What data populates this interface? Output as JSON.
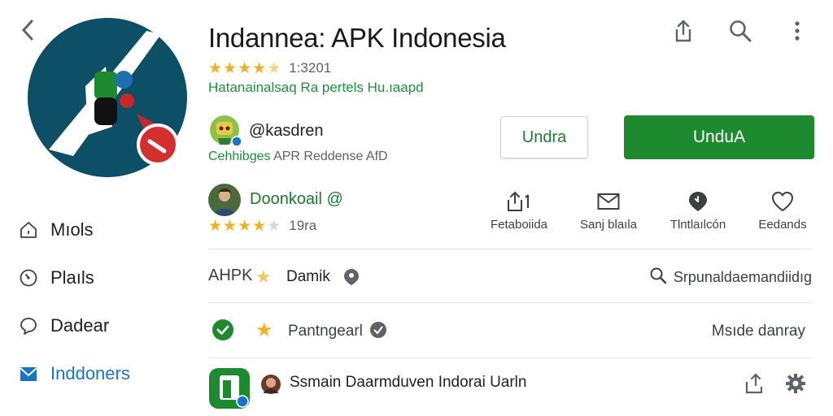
{
  "header": {
    "title": "Indannea: APK Indonesia",
    "rating_count": "1:3201",
    "developer_line": "Hatanainalsaq Ra pertels  Hu.ıaapd"
  },
  "developer": {
    "handle": "@kasdren",
    "sub_green": "Cehhibges",
    "sub_rest": " APR Reddense AfD"
  },
  "buttons": {
    "secondary_label": "Undra",
    "primary_label": "UnduA"
  },
  "sidebar": {
    "items": [
      {
        "label": "Mıols",
        "icon": "home-icon",
        "active": false
      },
      {
        "label": "Plaıls",
        "icon": "clock-icon",
        "active": false
      },
      {
        "label": "Dadear",
        "icon": "chat-bubble-icon",
        "active": false
      },
      {
        "label": "Inddoners",
        "icon": "inbox-icon",
        "active": true
      }
    ]
  },
  "section": {
    "title": "Doonkoail @",
    "rating_count": "19ra"
  },
  "actions": [
    {
      "label": "Fetaboiida",
      "icon": "share-icon"
    },
    {
      "label": "Sanj blaıla",
      "icon": "mail-icon"
    },
    {
      "label": "Tlntlaılcón",
      "icon": "location-pin-icon"
    },
    {
      "label": "Eedands",
      "icon": "heart-icon"
    }
  ],
  "row_a": {
    "label": "AHPK",
    "name": "Damik",
    "search_label": "Srpunaldaemandiidıg"
  },
  "row_b": {
    "label": "Pantngearl",
    "right_text": "Msıde danray"
  },
  "row_c": {
    "label": "Ssmain Daarmduven Indorai Uarln"
  },
  "colors": {
    "accent_green": "#1e8a2f",
    "link_green": "#1e8e3e",
    "star": "#f2b01e",
    "icon_teal": "#0d4f66",
    "active_blue": "#1a73c8"
  }
}
